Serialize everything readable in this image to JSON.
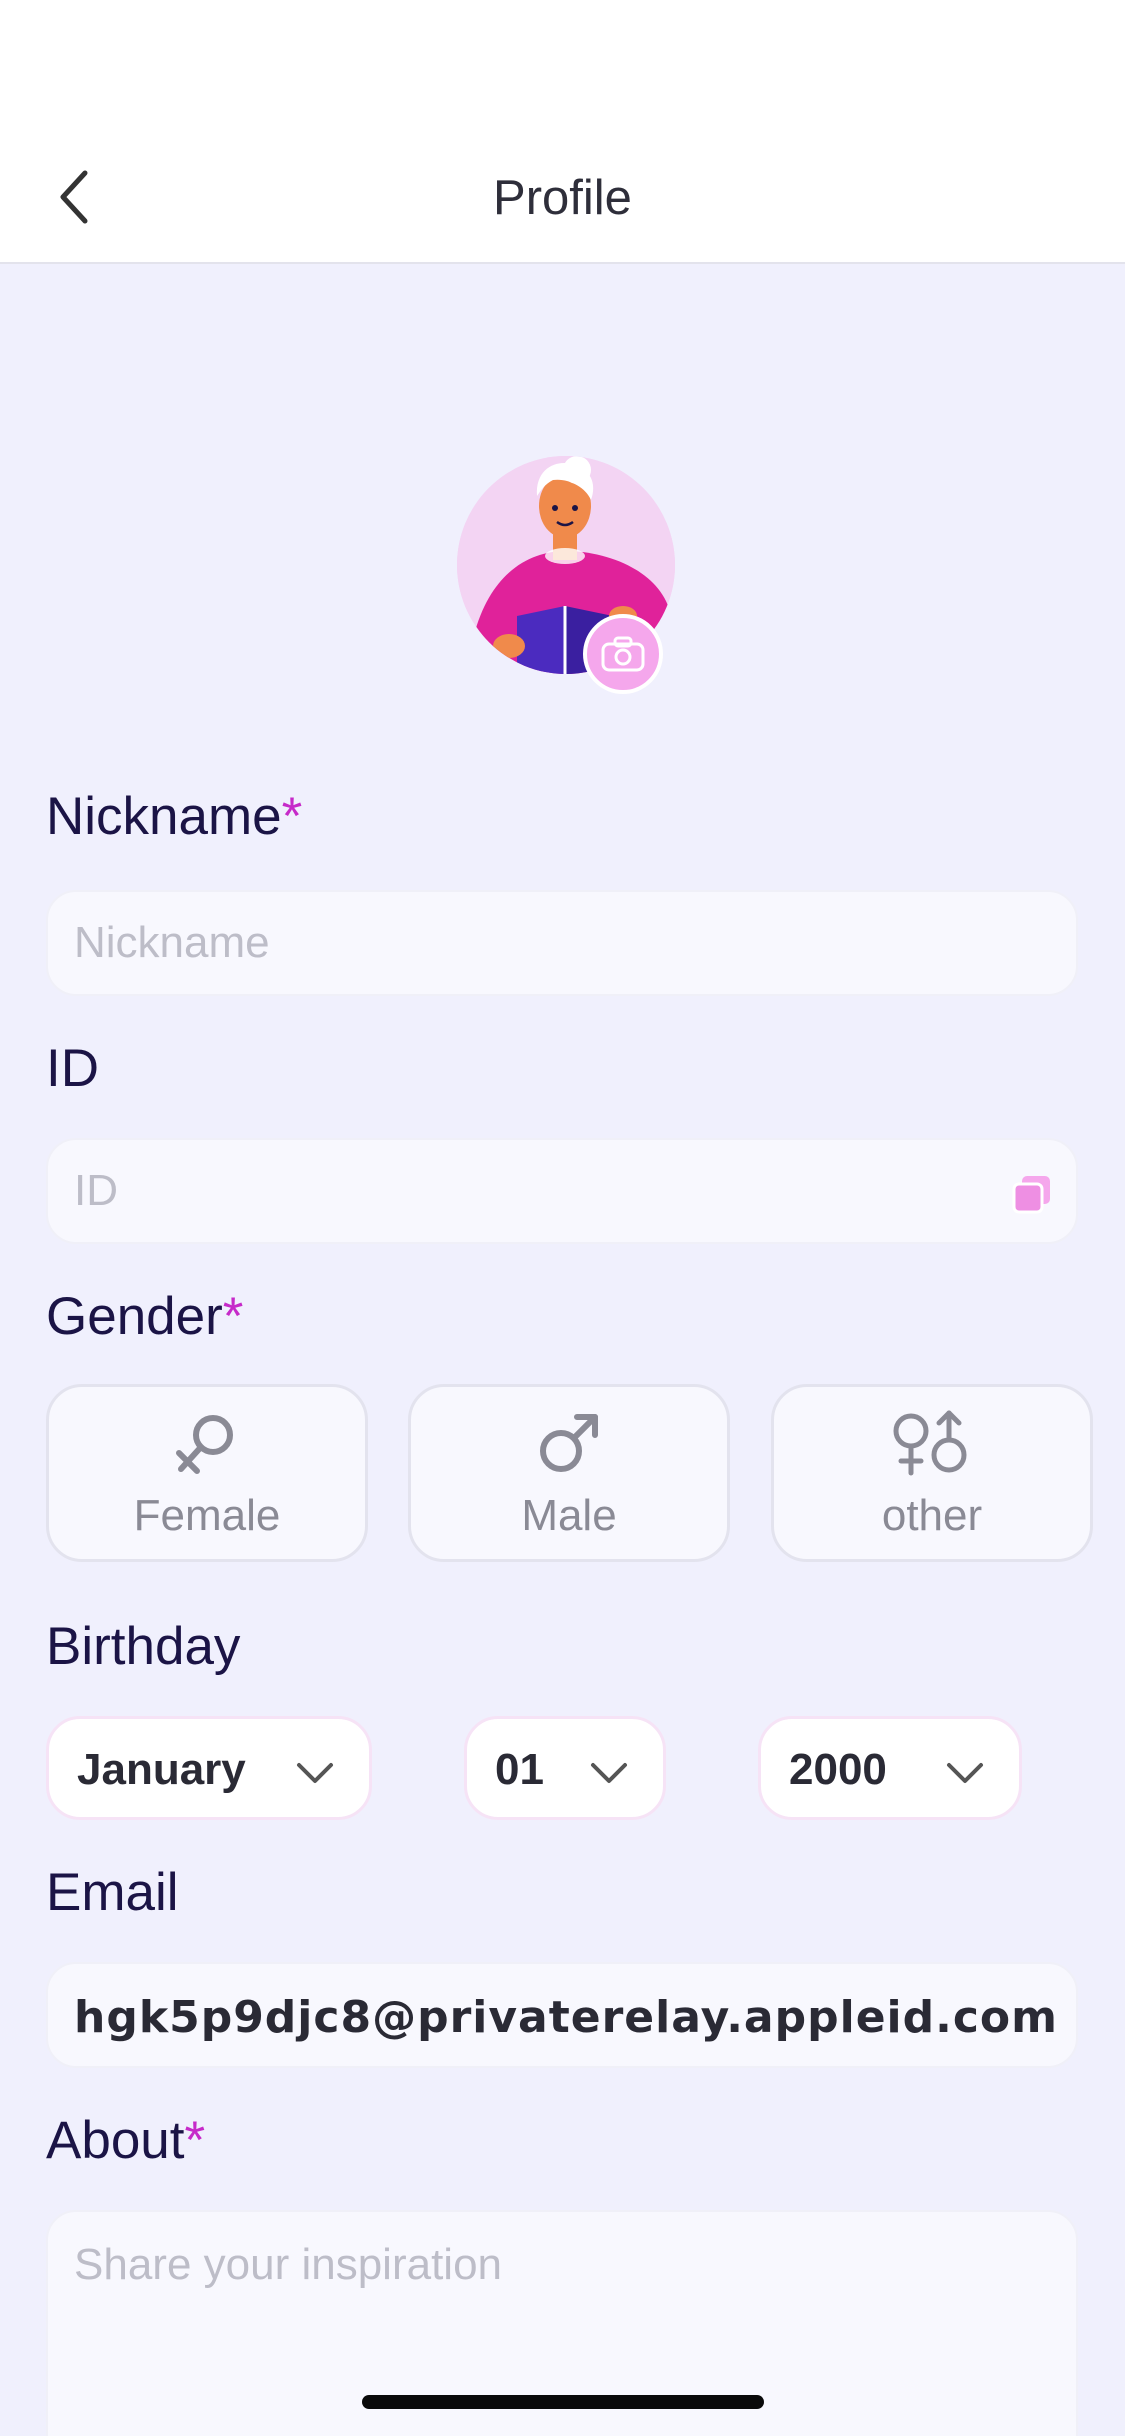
{
  "header": {
    "title": "Profile"
  },
  "form": {
    "nickname": {
      "label": "Nickname",
      "required_mark": "*",
      "placeholder": "Nickname"
    },
    "id": {
      "label": "ID",
      "placeholder": "ID"
    },
    "gender": {
      "label": "Gender",
      "required_mark": "*",
      "options": [
        {
          "label": "Female",
          "icon": "female-icon"
        },
        {
          "label": "Male",
          "icon": "male-icon"
        },
        {
          "label": "other",
          "icon": "other-gender-icon"
        }
      ]
    },
    "birthday": {
      "label": "Birthday",
      "month": "January",
      "day": "01",
      "year": "2000"
    },
    "email": {
      "label": "Email",
      "value": "hgk5p9djc8@privaterelay.appleid.com"
    },
    "about": {
      "label": "About",
      "required_mark": "*",
      "placeholder": "Share your inspiration"
    }
  },
  "colors": {
    "background": "#F0F0FD",
    "accent": "#C62AC9",
    "label": "#1B1446"
  }
}
